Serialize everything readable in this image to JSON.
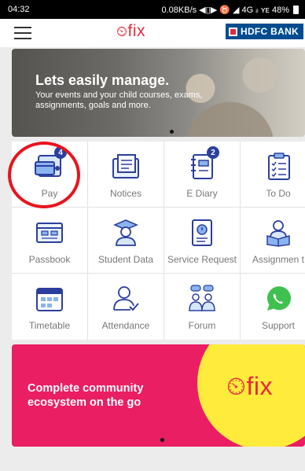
{
  "status_bar": {
    "time": "04:32",
    "indicators": "0.08KB/s  ◀▯▶ ♉ ◢ 4G ᵢₗ ʏᴇ 48%"
  },
  "app_bar": {
    "logo_text": "fix",
    "bank_label": "HDFC BANK"
  },
  "banner": {
    "title": "Lets easily manage.",
    "subtitle": "Your events and your child courses, exams, assignments, goals and more."
  },
  "tiles": [
    {
      "label": "Pay",
      "icon": "wallet-card-icon",
      "badge": "4"
    },
    {
      "label": "Notices",
      "icon": "notice-board-icon"
    },
    {
      "label": "E Diary",
      "icon": "diary-icon",
      "badge": "2"
    },
    {
      "label": "To Do",
      "icon": "checklist-icon"
    },
    {
      "label": "Passbook",
      "icon": "passbook-icon"
    },
    {
      "label": "Student Data",
      "icon": "student-icon"
    },
    {
      "label": "Service Request",
      "icon": "service-request-icon"
    },
    {
      "label": "Assignmen t",
      "icon": "assignment-reader-icon"
    },
    {
      "label": "Timetable",
      "icon": "calendar-icon"
    },
    {
      "label": "Attendance",
      "icon": "attendance-icon"
    },
    {
      "label": "Forum",
      "icon": "forum-group-icon"
    },
    {
      "label": "Support",
      "icon": "whatsapp-icon"
    }
  ],
  "promo": {
    "text": "Complete community ecosystem on the go",
    "logo_text": "fix"
  },
  "colors": {
    "brand_red": "#e6283c",
    "promo_pink": "#e91e63",
    "promo_yellow": "#ffeb3b",
    "icon_blue": "#2b3f9e",
    "bank_blue": "#004c8f",
    "highlight_circle": "#e8141e"
  }
}
